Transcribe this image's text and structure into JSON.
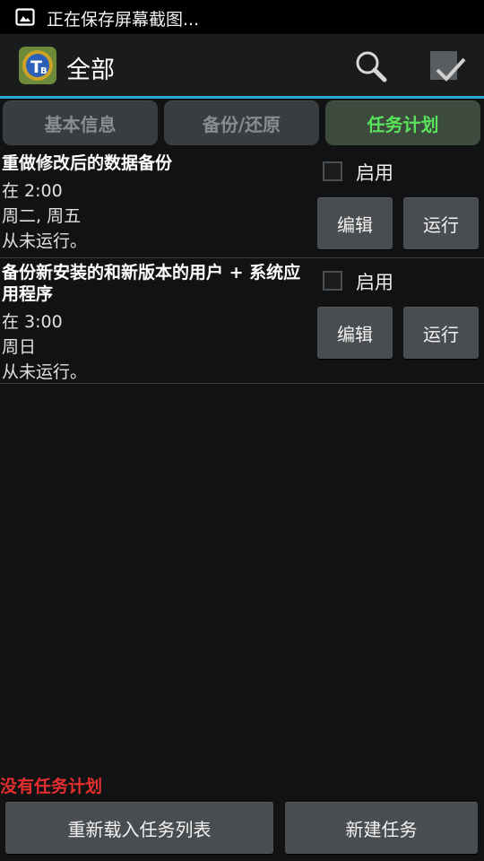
{
  "status_bar": {
    "notification_text": "正在保存屏幕截图..."
  },
  "action_bar": {
    "title": "全部"
  },
  "tabs": [
    {
      "label": "基本信息",
      "active": false
    },
    {
      "label": "备份/还原",
      "active": false
    },
    {
      "label": "任务计划",
      "active": true
    }
  ],
  "tasks": [
    {
      "title": "重做修改后的数据备份",
      "time": "在 2:00",
      "days": "周二, 周五",
      "last_run": "从未运行。",
      "enable_label": "启用",
      "enabled": false,
      "edit_label": "编辑",
      "run_label": "运行"
    },
    {
      "title": "备份新安装的和新版本的用户 + 系统应用程序",
      "time": "在 3:00",
      "days": "周日",
      "last_run": "从未运行。",
      "enable_label": "启用",
      "enabled": false,
      "edit_label": "编辑",
      "run_label": "运行"
    }
  ],
  "footer": {
    "empty_message": "没有任务计划",
    "reload_label": "重新载入任务列表",
    "new_task_label": "新建任务"
  },
  "colors": {
    "accent": "#2aa8d4",
    "active_tab_text": "#58e35a",
    "error_text": "#e62e2e"
  }
}
